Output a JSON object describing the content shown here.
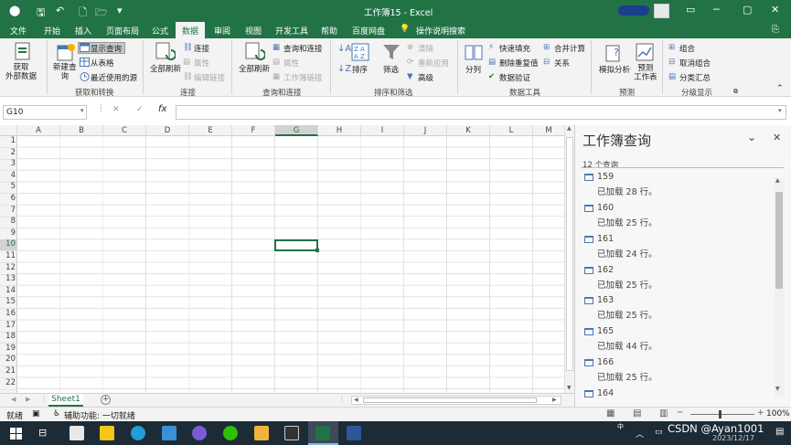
{
  "window": {
    "title": "工作簿15  -  Excel",
    "controls": {
      "restore": "▭",
      "minimize": "─",
      "maximize": "▢",
      "close": "✕"
    }
  },
  "menu_tabs": [
    "文件",
    "开始",
    "插入",
    "页面布局",
    "公式",
    "数据",
    "审阅",
    "视图",
    "开发工具",
    "帮助",
    "百度网盘"
  ],
  "menu_active": "数据",
  "tell_me": "操作说明搜索",
  "ribbon": {
    "get_data": "获取\n外部数据",
    "new_query": "新建查\n询",
    "show_queries": "显示查询",
    "from_table": "从表格",
    "recent_sources": "最近使用的源",
    "group_get_transform": "获取和转换",
    "refresh_all_1": "全部刷新",
    "connections": "连接",
    "properties": "属性",
    "edit_links": "编辑链接",
    "group_connections": "连接",
    "refresh_all_2": "全部刷新",
    "queries_connections": "查询和连接",
    "properties_2": "属性",
    "workbook_links": "工作簿链接",
    "group_queries": "查询和连接",
    "sort": "排序",
    "filter": "筛选",
    "clear": "清除",
    "reapply": "重新应用",
    "advanced": "高级",
    "group_sort_filter": "排序和筛选",
    "split": "分列",
    "flash_fill": "快速填充",
    "remove_dup": "删除重复值",
    "data_validation": "数据验证",
    "consolidate": "合并计算",
    "relationships": "关系",
    "group_data_tools": "数据工具",
    "what_if": "模拟分析",
    "forecast": "预测\n工作表",
    "group_forecast": "预测",
    "group": "组合",
    "ungroup": "取消组合",
    "subtotal": "分类汇总",
    "group_outline": "分级显示"
  },
  "formula_bar": {
    "name_box": "G10",
    "fx": "fx",
    "cancel": "✕",
    "enter": "✓",
    "formula": ""
  },
  "columns": [
    "A",
    "B",
    "C",
    "D",
    "E",
    "F",
    "G",
    "H",
    "I",
    "J",
    "K",
    "L",
    "M"
  ],
  "rows": [
    "1",
    "2",
    "3",
    "4",
    "5",
    "6",
    "7",
    "8",
    "9",
    "10",
    "11",
    "12",
    "13",
    "14",
    "15",
    "16",
    "17",
    "18",
    "19",
    "20",
    "21",
    "22"
  ],
  "selected_cell": "G10",
  "sheet_tab": "Sheet1",
  "add_sheet": "+",
  "panel": {
    "title": "工作簿查询",
    "count": "12 个查询",
    "queries": [
      {
        "name": "159",
        "status": "已加载 28 行。"
      },
      {
        "name": "160",
        "status": "已加载 25 行。"
      },
      {
        "name": "161",
        "status": "已加载 24 行。"
      },
      {
        "name": "162",
        "status": "已加载 25 行。"
      },
      {
        "name": "163",
        "status": "已加载 25 行。"
      },
      {
        "name": "165",
        "status": "已加载 44 行。"
      },
      {
        "name": "166",
        "status": "已加载 25 行。"
      },
      {
        "name": "164",
        "status": ""
      }
    ]
  },
  "status": {
    "ready": "就绪",
    "accessibility": "辅助功能: 一切就绪",
    "zoom": "100%",
    "zoom_minus": "─",
    "zoom_plus": "+"
  },
  "taskbar": {
    "watermark": "CSDN @Ayan1001",
    "date": "2023/12/17",
    "ime": "中"
  }
}
